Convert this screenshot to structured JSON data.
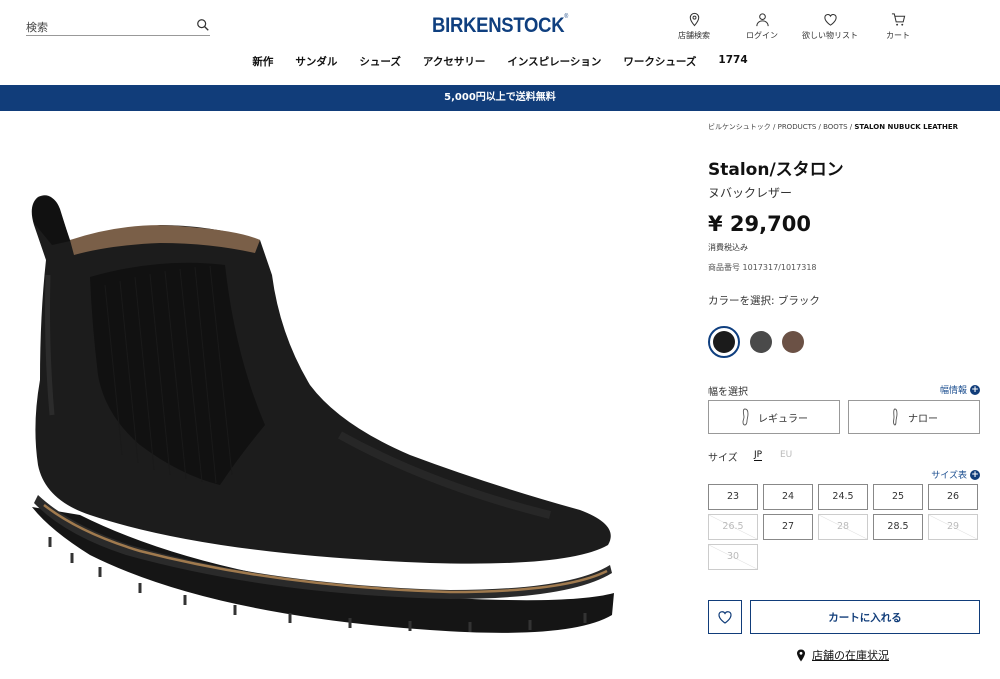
{
  "header": {
    "search_placeholder": "検索",
    "logo": "BIRKENSTOCK",
    "logo_mark": "®",
    "icons": [
      {
        "icon": "map-pin-icon",
        "label": "店舗検索"
      },
      {
        "icon": "user-icon",
        "label": "ログイン"
      },
      {
        "icon": "heart-icon",
        "label": "欲しい物リスト"
      },
      {
        "icon": "cart-icon",
        "label": "カート"
      }
    ]
  },
  "nav": [
    "新作",
    "サンダル",
    "シューズ",
    "アクセサリー",
    "インスピレーション",
    "ワークシューズ",
    "1774"
  ],
  "banner": "5,000円以上で送料無料",
  "breadcrumb": {
    "parts": "ビルケンシュトック / PRODUCTS / BOOTS / ",
    "current": "STALON NUBUCK LEATHER"
  },
  "product": {
    "title": "Stalon/スタロン",
    "subtitle": "ヌバックレザー",
    "price": "¥ 29,700",
    "tax_note": "消費税込み",
    "sku": "商品番号 1017317/1017318",
    "color_label": "カラーを選択: ブラック",
    "swatches": [
      {
        "name": "black",
        "color": "#1b1b1b",
        "selected": true
      },
      {
        "name": "grey",
        "color": "#4a4a4a",
        "selected": false
      },
      {
        "name": "brown",
        "color": "#6b5145",
        "selected": false
      }
    ],
    "image_icon": "chelsea-boot-image"
  },
  "width": {
    "label": "幅を選択",
    "info": "幅情報",
    "options": [
      "レギュラー",
      "ナロー"
    ]
  },
  "size": {
    "label": "サイズ",
    "systems": [
      "JP",
      "EU"
    ],
    "active_system": "JP",
    "chart": "サイズ表",
    "options": [
      {
        "label": "23",
        "available": true
      },
      {
        "label": "24",
        "available": true
      },
      {
        "label": "24.5",
        "available": true
      },
      {
        "label": "25",
        "available": true
      },
      {
        "label": "26",
        "available": true
      },
      {
        "label": "26.5",
        "available": false
      },
      {
        "label": "27",
        "available": true
      },
      {
        "label": "28",
        "available": false
      },
      {
        "label": "28.5",
        "available": true
      },
      {
        "label": "29",
        "available": false
      },
      {
        "label": "30",
        "available": false
      }
    ]
  },
  "actions": {
    "add_to_cart": "カートに入れる",
    "store_stock": "店舗の在庫状況"
  },
  "colors": {
    "brand": "#0f3f7f",
    "banner_bg": "#113d7a",
    "link": "#1a4d8f"
  }
}
